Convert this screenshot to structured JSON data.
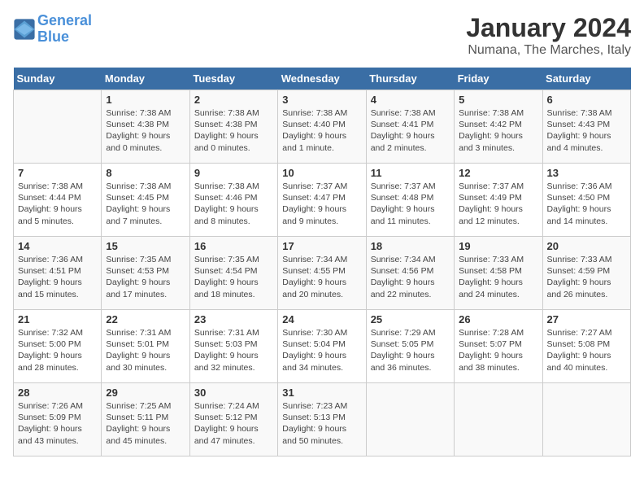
{
  "logo": {
    "line1": "General",
    "line2": "Blue"
  },
  "title": "January 2024",
  "subtitle": "Numana, The Marches, Italy",
  "days_of_week": [
    "Sunday",
    "Monday",
    "Tuesday",
    "Wednesday",
    "Thursday",
    "Friday",
    "Saturday"
  ],
  "weeks": [
    [
      {
        "num": "",
        "info": ""
      },
      {
        "num": "1",
        "info": "Sunrise: 7:38 AM\nSunset: 4:38 PM\nDaylight: 9 hours\nand 0 minutes."
      },
      {
        "num": "2",
        "info": "Sunrise: 7:38 AM\nSunset: 4:38 PM\nDaylight: 9 hours\nand 0 minutes."
      },
      {
        "num": "3",
        "info": "Sunrise: 7:38 AM\nSunset: 4:40 PM\nDaylight: 9 hours\nand 1 minute."
      },
      {
        "num": "4",
        "info": "Sunrise: 7:38 AM\nSunset: 4:41 PM\nDaylight: 9 hours\nand 2 minutes."
      },
      {
        "num": "5",
        "info": "Sunrise: 7:38 AM\nSunset: 4:42 PM\nDaylight: 9 hours\nand 3 minutes."
      },
      {
        "num": "6",
        "info": "Sunrise: 7:38 AM\nSunset: 4:43 PM\nDaylight: 9 hours\nand 4 minutes."
      }
    ],
    [
      {
        "num": "7",
        "info": "Sunrise: 7:38 AM\nSunset: 4:44 PM\nDaylight: 9 hours\nand 5 minutes."
      },
      {
        "num": "8",
        "info": "Sunrise: 7:38 AM\nSunset: 4:45 PM\nDaylight: 9 hours\nand 7 minutes."
      },
      {
        "num": "9",
        "info": "Sunrise: 7:38 AM\nSunset: 4:46 PM\nDaylight: 9 hours\nand 8 minutes."
      },
      {
        "num": "10",
        "info": "Sunrise: 7:37 AM\nSunset: 4:47 PM\nDaylight: 9 hours\nand 9 minutes."
      },
      {
        "num": "11",
        "info": "Sunrise: 7:37 AM\nSunset: 4:48 PM\nDaylight: 9 hours\nand 11 minutes."
      },
      {
        "num": "12",
        "info": "Sunrise: 7:37 AM\nSunset: 4:49 PM\nDaylight: 9 hours\nand 12 minutes."
      },
      {
        "num": "13",
        "info": "Sunrise: 7:36 AM\nSunset: 4:50 PM\nDaylight: 9 hours\nand 14 minutes."
      }
    ],
    [
      {
        "num": "14",
        "info": "Sunrise: 7:36 AM\nSunset: 4:51 PM\nDaylight: 9 hours\nand 15 minutes."
      },
      {
        "num": "15",
        "info": "Sunrise: 7:35 AM\nSunset: 4:53 PM\nDaylight: 9 hours\nand 17 minutes."
      },
      {
        "num": "16",
        "info": "Sunrise: 7:35 AM\nSunset: 4:54 PM\nDaylight: 9 hours\nand 18 minutes."
      },
      {
        "num": "17",
        "info": "Sunrise: 7:34 AM\nSunset: 4:55 PM\nDaylight: 9 hours\nand 20 minutes."
      },
      {
        "num": "18",
        "info": "Sunrise: 7:34 AM\nSunset: 4:56 PM\nDaylight: 9 hours\nand 22 minutes."
      },
      {
        "num": "19",
        "info": "Sunrise: 7:33 AM\nSunset: 4:58 PM\nDaylight: 9 hours\nand 24 minutes."
      },
      {
        "num": "20",
        "info": "Sunrise: 7:33 AM\nSunset: 4:59 PM\nDaylight: 9 hours\nand 26 minutes."
      }
    ],
    [
      {
        "num": "21",
        "info": "Sunrise: 7:32 AM\nSunset: 5:00 PM\nDaylight: 9 hours\nand 28 minutes."
      },
      {
        "num": "22",
        "info": "Sunrise: 7:31 AM\nSunset: 5:01 PM\nDaylight: 9 hours\nand 30 minutes."
      },
      {
        "num": "23",
        "info": "Sunrise: 7:31 AM\nSunset: 5:03 PM\nDaylight: 9 hours\nand 32 minutes."
      },
      {
        "num": "24",
        "info": "Sunrise: 7:30 AM\nSunset: 5:04 PM\nDaylight: 9 hours\nand 34 minutes."
      },
      {
        "num": "25",
        "info": "Sunrise: 7:29 AM\nSunset: 5:05 PM\nDaylight: 9 hours\nand 36 minutes."
      },
      {
        "num": "26",
        "info": "Sunrise: 7:28 AM\nSunset: 5:07 PM\nDaylight: 9 hours\nand 38 minutes."
      },
      {
        "num": "27",
        "info": "Sunrise: 7:27 AM\nSunset: 5:08 PM\nDaylight: 9 hours\nand 40 minutes."
      }
    ],
    [
      {
        "num": "28",
        "info": "Sunrise: 7:26 AM\nSunset: 5:09 PM\nDaylight: 9 hours\nand 43 minutes."
      },
      {
        "num": "29",
        "info": "Sunrise: 7:25 AM\nSunset: 5:11 PM\nDaylight: 9 hours\nand 45 minutes."
      },
      {
        "num": "30",
        "info": "Sunrise: 7:24 AM\nSunset: 5:12 PM\nDaylight: 9 hours\nand 47 minutes."
      },
      {
        "num": "31",
        "info": "Sunrise: 7:23 AM\nSunset: 5:13 PM\nDaylight: 9 hours\nand 50 minutes."
      },
      {
        "num": "",
        "info": ""
      },
      {
        "num": "",
        "info": ""
      },
      {
        "num": "",
        "info": ""
      }
    ]
  ]
}
